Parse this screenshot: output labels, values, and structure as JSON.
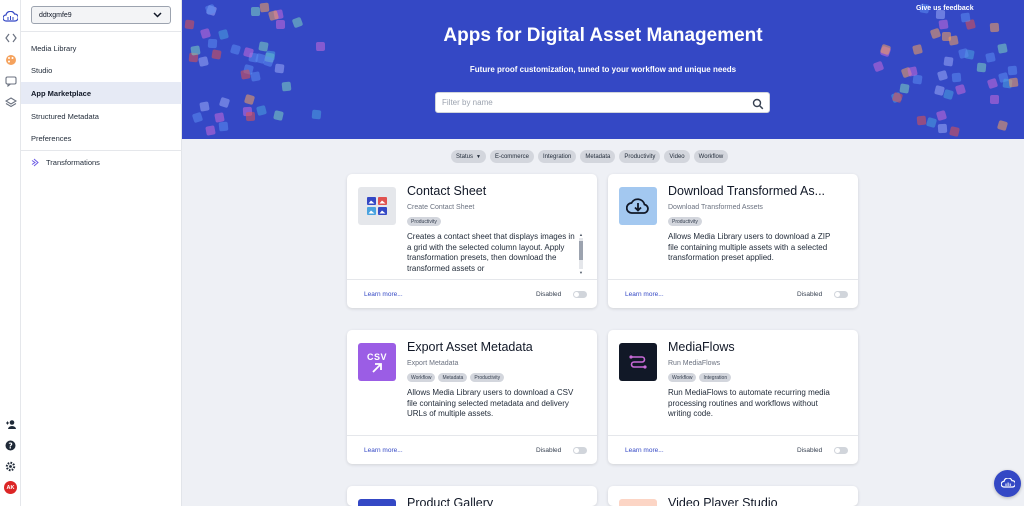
{
  "rail": {
    "top_icons": [
      "cloud-logo-icon",
      "code-brackets-icon",
      "palette-icon",
      "chat-icon",
      "layers-icon"
    ],
    "bottom_icons": [
      "add-user-icon",
      "help-icon",
      "gear-icon"
    ],
    "avatar_initials": "AK"
  },
  "sidenav": {
    "environment": "ddtxgmfe9",
    "items": [
      {
        "label": "Media Library",
        "active": false
      },
      {
        "label": "Studio",
        "active": false
      },
      {
        "label": "App Marketplace",
        "active": true
      },
      {
        "label": "Structured Metadata",
        "active": false
      },
      {
        "label": "Preferences",
        "active": false
      }
    ],
    "transformations_label": "Transformations"
  },
  "banner": {
    "title": "Apps for Digital Asset Management",
    "subtitle": "Future proof customization, tuned to your workflow and unique needs",
    "search_placeholder": "Filter by name",
    "feedback_label": "Give us feedback"
  },
  "filters": [
    {
      "label": "Status",
      "dropdown": true
    },
    {
      "label": "E-commerce"
    },
    {
      "label": "Integration"
    },
    {
      "label": "Metadata"
    },
    {
      "label": "Productivity"
    },
    {
      "label": "Video"
    },
    {
      "label": "Workflow"
    }
  ],
  "cards": [
    {
      "title": "Contact Sheet",
      "subtitle": "Create Contact Sheet",
      "tags": [
        "Productivity"
      ],
      "description": "Creates a contact sheet that displays images in a grid with the selected column layout. Apply transformation presets, then download the transformed assets or",
      "learn_more": "Learn more...",
      "status": "Disabled",
      "icon": "contact-sheet-icon",
      "icon_bg": "#e5e7eb"
    },
    {
      "title": "Download Transformed As...",
      "subtitle": "Download Transformed Assets",
      "tags": [
        "Productivity"
      ],
      "description": "Allows Media Library users to download a ZIP file containing multiple assets with a selected transformation preset applied.",
      "learn_more": "Learn more...",
      "status": "Disabled",
      "icon": "cloud-download-icon",
      "icon_bg": "#a3c8f0"
    },
    {
      "title": "Export Asset Metadata",
      "subtitle": "Export Metadata",
      "tags": [
        "Workflow",
        "Metadata",
        "Productivity"
      ],
      "description": "Allows Media Library users to download a CSV file containing selected metadata and delivery URLs of multiple assets.",
      "learn_more": "Learn more...",
      "status": "Disabled",
      "icon": "csv-export-icon",
      "icon_text": "CSV",
      "icon_bg": "#9b5de5"
    },
    {
      "title": "MediaFlows",
      "subtitle": "Run MediaFlows",
      "tags": [
        "Workflow",
        "Integration"
      ],
      "description": "Run MediaFlows to automate recurring media processing routines and workflows without writing code.",
      "learn_more": "Learn more...",
      "status": "Disabled",
      "icon": "mediaflows-icon",
      "icon_bg": "#111827"
    },
    {
      "title": "Product Gallery",
      "icon": "product-gallery-icon",
      "icon_bg": "#3448c5"
    },
    {
      "title": "Video Player Studio",
      "icon": "video-player-icon",
      "icon_bg": "#fcd5c5"
    }
  ],
  "colors": {
    "brand": "#3448c5",
    "page_bg": "#eef0f5",
    "avatar": "#dc2626"
  }
}
